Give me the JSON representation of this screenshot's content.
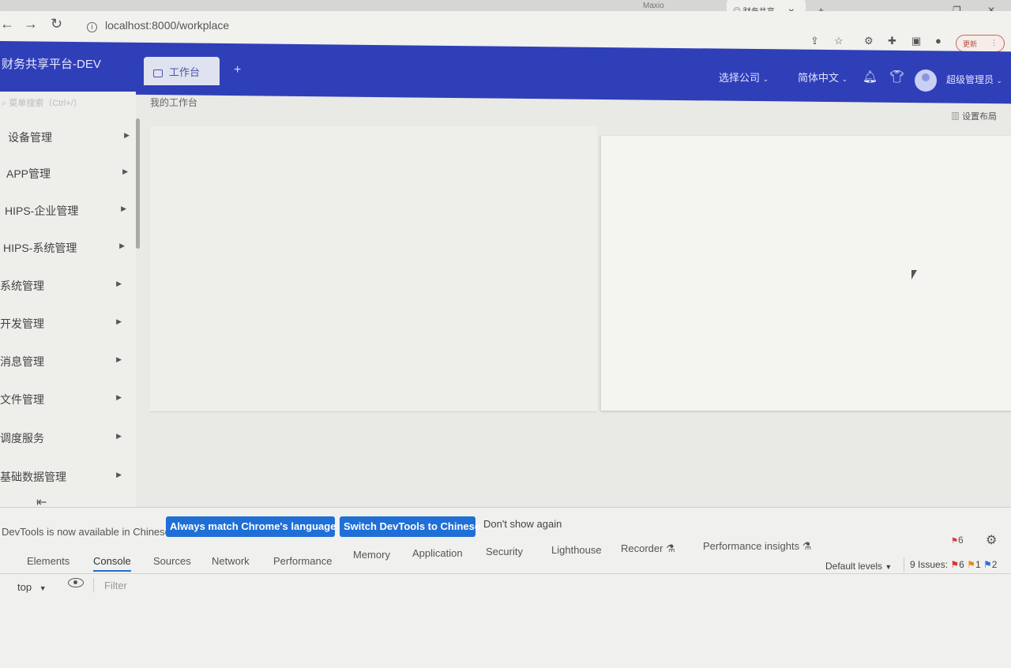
{
  "browser": {
    "tabs": [
      {
        "label": ""
      },
      {
        "label": ""
      },
      {
        "label": ""
      },
      {
        "label": "Maxio"
      },
      {
        "label": ""
      }
    ],
    "active_tab": {
      "label": "财务共享"
    },
    "url": "localhost:8000/workplace",
    "update_label": "更新"
  },
  "app": {
    "title": "财务共享平台-DEV",
    "workspace_tab": "工作台",
    "company_select": "选择公司",
    "language_select": "简体中文",
    "user_name": "超级管理员"
  },
  "sidebar": {
    "search_placeholder": "菜单搜索（Ctrl+/）",
    "items": [
      {
        "label": "设备管理"
      },
      {
        "label": "APP管理"
      },
      {
        "label": "HIPS-企业管理"
      },
      {
        "label": "HIPS-系统管理"
      },
      {
        "label": "系统管理"
      },
      {
        "label": "开发管理"
      },
      {
        "label": "消息管理"
      },
      {
        "label": "文件管理"
      },
      {
        "label": "调度服务"
      },
      {
        "label": "基础数据管理"
      }
    ]
  },
  "main": {
    "breadcrumb": "我的工作台",
    "layout_settings": "设置布局"
  },
  "devtools": {
    "notice": "DevTools is now available in Chinese!",
    "btn_match": "Always match Chrome's language",
    "btn_switch": "Switch DevTools to Chinese",
    "dont_show": "Don't show again",
    "error_count": "6",
    "tabs": [
      {
        "label": "Elements"
      },
      {
        "label": "Console"
      },
      {
        "label": "Sources"
      },
      {
        "label": "Network"
      },
      {
        "label": "Performance"
      },
      {
        "label": "Memory"
      },
      {
        "label": "Application"
      },
      {
        "label": "Security"
      },
      {
        "label": "Lighthouse"
      },
      {
        "label": "Recorder"
      },
      {
        "label": "Performance insights"
      }
    ],
    "default_levels": "Default levels",
    "issues_label": "9 Issues:",
    "issues_red": "6",
    "issues_orange": "1",
    "issues_blue": "2",
    "context": "top",
    "filter_placeholder": "Filter"
  }
}
